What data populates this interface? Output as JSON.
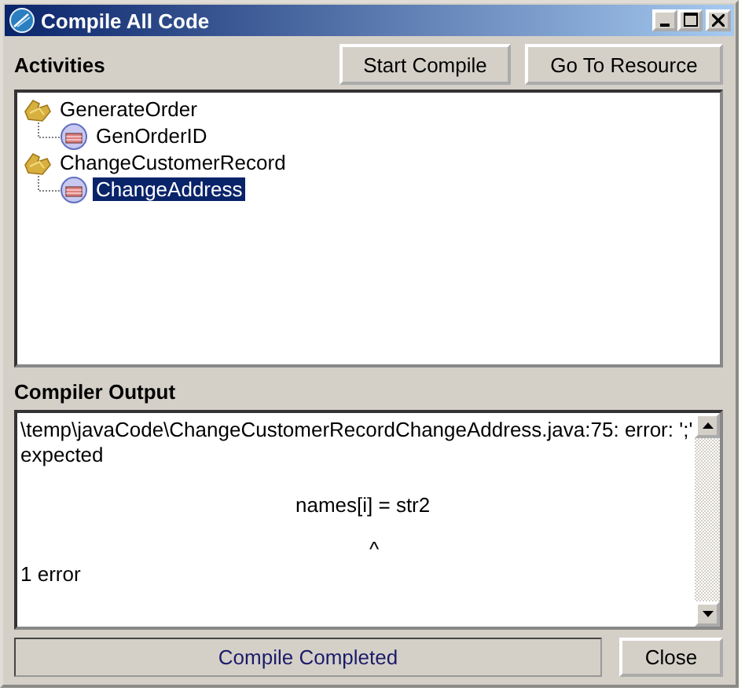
{
  "window": {
    "title": "Compile All Code"
  },
  "activities": {
    "label": "Activities",
    "buttons": [
      "Start Compile",
      "Go To Resource"
    ],
    "tree": [
      {
        "label": "GenerateOrder",
        "children": [
          {
            "label": "GenOrderID",
            "selected": false
          }
        ]
      },
      {
        "label": "ChangeCustomerRecord",
        "children": [
          {
            "label": "ChangeAddress",
            "selected": true
          }
        ]
      }
    ]
  },
  "output": {
    "label": "Compiler Output",
    "lines": [
      {
        "kind": "message",
        "text": "\\temp\\javaCode\\ChangeCustomerRecordChangeAddress.java:75: error: ';' expected"
      },
      {
        "kind": "source",
        "text": "names[i] = str2"
      },
      {
        "kind": "caret",
        "text": "^"
      },
      {
        "kind": "summary",
        "text": "1 error"
      }
    ]
  },
  "status": "Compile Completed",
  "close_button": "Close"
}
